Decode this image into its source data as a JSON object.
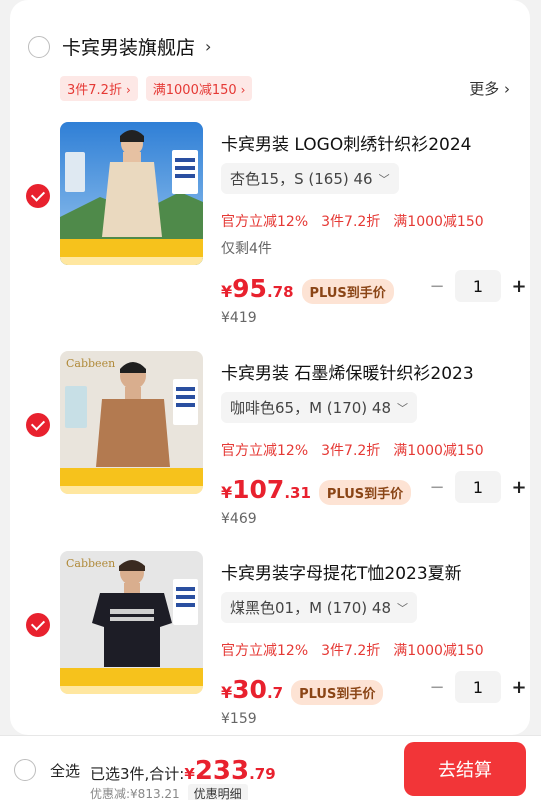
{
  "store": {
    "name": "卡宾男装旗舰店",
    "chevron": "›"
  },
  "store_tags": [
    {
      "label": "3件7.2折",
      "arrow": "›"
    },
    {
      "label": "满1000减150",
      "arrow": "›"
    }
  ],
  "more": {
    "label": "更多 ›"
  },
  "items": [
    {
      "title": "卡宾男装 LOGO刺绣针织衫2024",
      "variant": "杏色15，S (165) 46",
      "promos": [
        "官方立减12%",
        "3件7.2折",
        "满1000减150"
      ],
      "stock": "仅剩4件",
      "price": {
        "currency": "¥",
        "int": "95",
        "dec": ".78"
      },
      "plus_label": "PLUS到手价",
      "orig_price": "¥419",
      "qty": "1"
    },
    {
      "title": "卡宾男装 石墨烯保暖针织衫2023",
      "variant": "咖啡色65，M (170) 48",
      "promos": [
        "官方立减12%",
        "3件7.2折",
        "满1000减150"
      ],
      "price": {
        "currency": "¥",
        "int": "107",
        "dec": ".31"
      },
      "plus_label": "PLUS到手价",
      "orig_price": "¥469",
      "qty": "1"
    },
    {
      "title": "卡宾男装字母提花T恤2023夏新",
      "variant": "煤黑色01，M (170) 48",
      "promos": [
        "官方立减12%",
        "3件7.2折",
        "满1000减150"
      ],
      "price": {
        "currency": "¥",
        "int": "30",
        "dec": ".7"
      },
      "plus_label": "PLUS到手价",
      "orig_price": "¥159",
      "qty": "1"
    }
  ],
  "controls": {
    "minus": "−",
    "plus": "+",
    "variant_chevron": "﹀"
  },
  "footer": {
    "select_all": "全选",
    "selected_text": "已选3件,合计:",
    "total": {
      "currency": "¥",
      "int": "233",
      "dec": ".79"
    },
    "discount_text": "优惠减:¥813.21",
    "discount_detail": "优惠明细",
    "checkout": "去结算"
  },
  "colors": {
    "accent": "#e8212e",
    "checkout": "#f23538",
    "tag_bg": "#fde8e6",
    "plus_bg": "#fde3d4"
  },
  "icons": [
    "chevron-right-icon",
    "chevron-down-icon",
    "check-icon",
    "minus-icon",
    "plus-icon"
  ]
}
